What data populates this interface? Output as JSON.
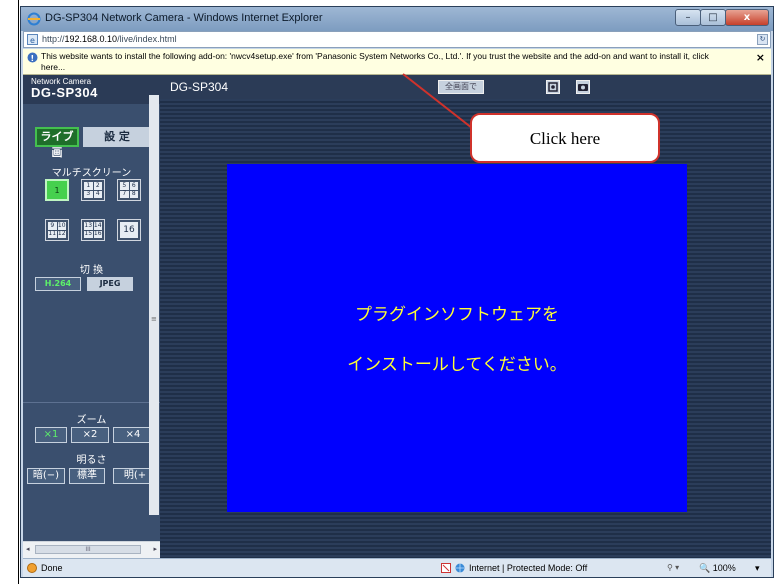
{
  "window": {
    "title": "DG-SP304 Network Camera - Windows Internet Explorer",
    "minimize": "–",
    "maximize": "□",
    "close": "x"
  },
  "address": {
    "prefix": "http://",
    "host": "192.168.0.10",
    "path": "/live/index.html",
    "icon": "ie-page-icon"
  },
  "infobar": {
    "message": "This website wants to install the following add-on: 'nwcv4setup.exe' from 'Panasonic System Networks Co., Ltd.'. If you trust the website and the add-on and want to install it, click here...",
    "close": "×"
  },
  "camera": {
    "brand_small": "Network Camera",
    "brand_model": "DG-SP304",
    "header_title": "DG-SP304",
    "header_button": "全画面で",
    "tab_live": "ライブ画",
    "tab_setup": "設 定",
    "multiscreen_label": "マルチスクリーン",
    "screens": [
      {
        "id": "1",
        "cells": [
          "1"
        ]
      },
      {
        "id": "1-4",
        "cells": [
          "1",
          "2",
          "3",
          "4"
        ]
      },
      {
        "id": "5-8",
        "cells": [
          "5",
          "6",
          "7",
          "8"
        ]
      },
      {
        "id": "9-12",
        "cells": [
          "9",
          "10",
          "11",
          "12"
        ]
      },
      {
        "id": "13-16",
        "cells": [
          "13",
          "14",
          "15",
          "16"
        ]
      },
      {
        "id": "16",
        "cells": [
          "16"
        ]
      }
    ],
    "switch_label": "切 換",
    "format_h264": "H.264",
    "format_jpeg": "JPEG",
    "zoom_label": "ズーム",
    "zoom_x1": "×1",
    "zoom_x2": "×2",
    "zoom_x4": "×4",
    "brightness_label": "明るさ",
    "bright_dark": "暗(−)",
    "bright_std": "標準",
    "bright_light": "明(+",
    "video_line1": "プラグインソフトウェアを",
    "video_line2": "インストールしてください。"
  },
  "callout": {
    "text": "Click here"
  },
  "status": {
    "done": "Done",
    "zone": "Internet | Protected Mode: Off",
    "zoom": "100%"
  },
  "colors": {
    "accent_green": "#46d04e",
    "video_blue": "#0000fe",
    "video_text": "#ffff33",
    "callout_border": "#d0322b"
  }
}
